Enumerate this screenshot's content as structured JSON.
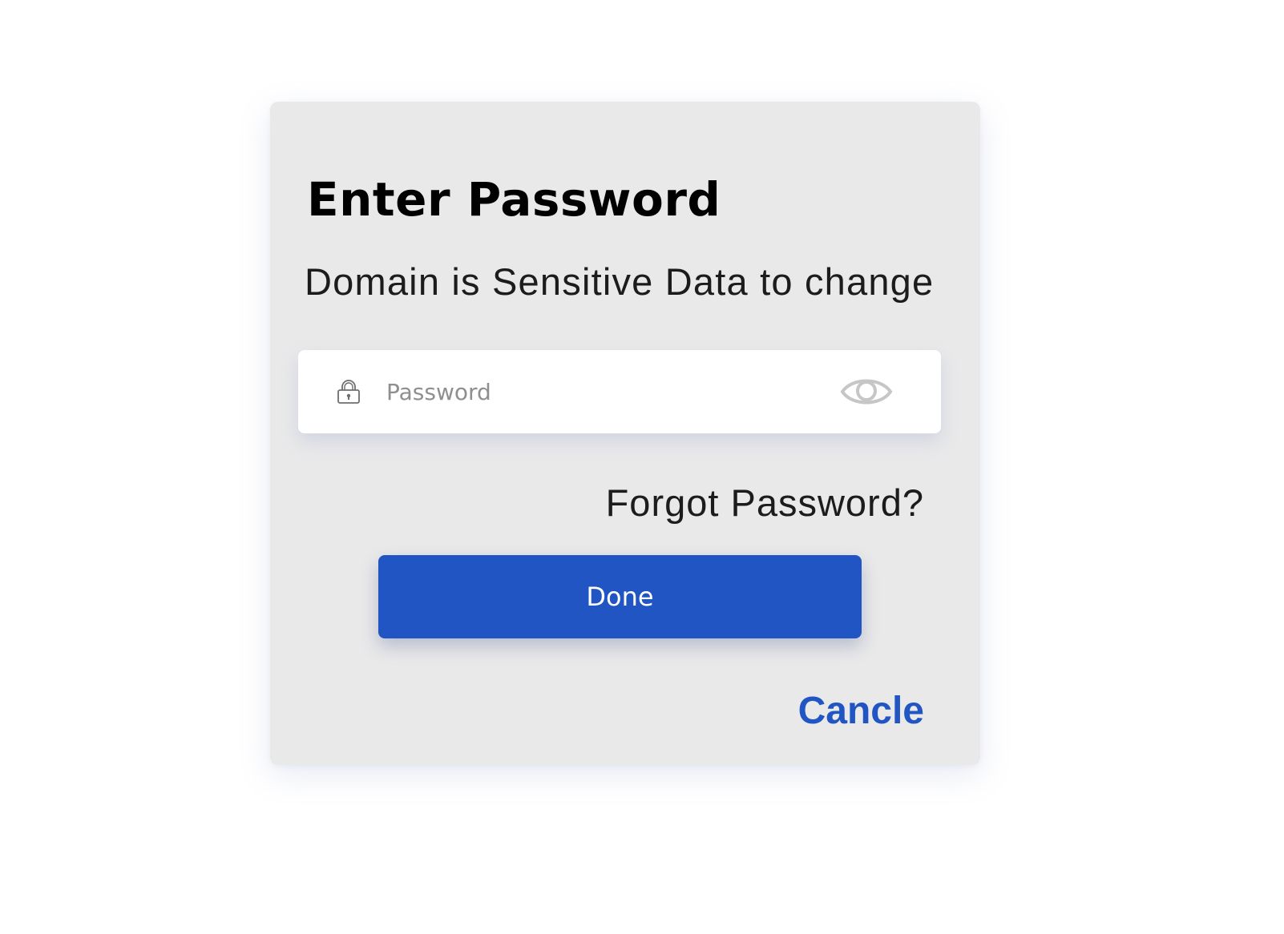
{
  "dialog": {
    "title": "Enter Password",
    "subtitle": "Domain is Sensitive Data to change",
    "password_field": {
      "placeholder": "Password",
      "value": "",
      "leading_icon": "lock-icon",
      "trailing_icon": "eye-icon"
    },
    "forgot_password_label": "Forgot Password?",
    "done_label": "Done",
    "cancel_label": "Cancle"
  },
  "colors": {
    "background": "#ffffff",
    "dialog_background": "#e9e9ea",
    "primary": "#2055c3",
    "text": "#1c1c1c",
    "placeholder": "#8f8f8f",
    "icon_light": "#c6c6c6"
  }
}
